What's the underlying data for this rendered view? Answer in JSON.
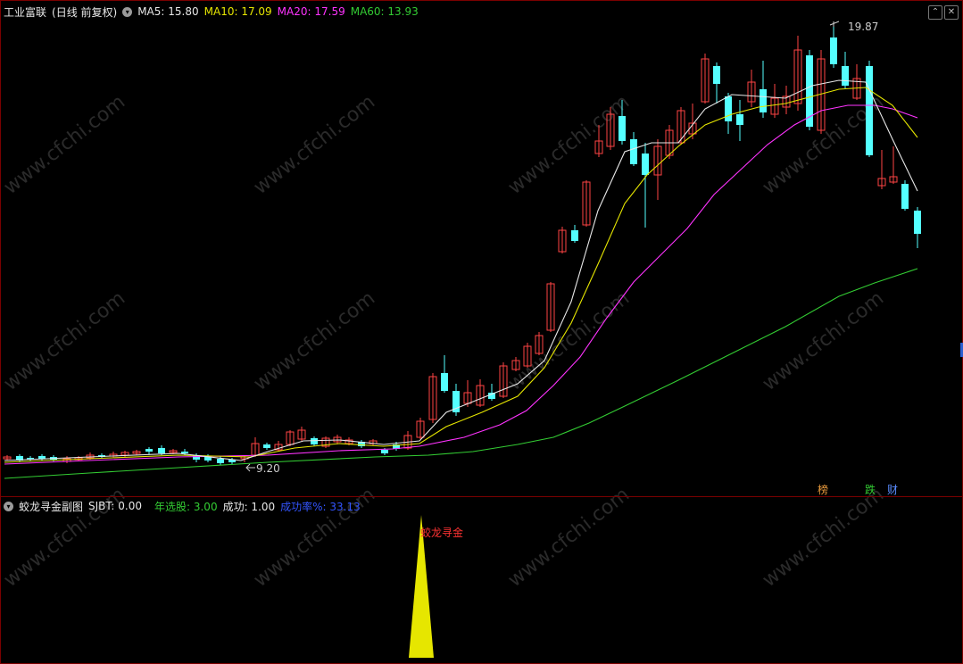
{
  "header": {
    "stock_name": "工业富联",
    "period": "(日线 前复权)",
    "ma": [
      {
        "label": "MA5: 15.80",
        "color": "#e8e8e8"
      },
      {
        "label": "MA10: 17.09",
        "color": "#e6e600"
      },
      {
        "label": "MA20: 17.59",
        "color": "#ff33ff"
      },
      {
        "label": "MA60: 13.93",
        "color": "#33cc33"
      }
    ]
  },
  "window_buttons": {
    "restore": "⌃",
    "close": "✕"
  },
  "main_chart": {
    "high_marker": "19.87",
    "low_marker": "9.20",
    "badges": [
      {
        "text": "榜",
        "color": "#e89a3c"
      },
      {
        "text": "跌",
        "color": "#33cc33"
      },
      {
        "text": "财",
        "color": "#5a8cff"
      }
    ]
  },
  "sub_header": {
    "indicator_name": "蛟龙寻金副图",
    "sjbt": "SJBT: 0.00",
    "nianxuangu": "年选股: 3.00",
    "chenggong": "成功: 1.00",
    "chenggonglv": "成功率%: 33.13"
  },
  "signal_label": "蛟龙寻金",
  "watermark": "www.cfchi.com",
  "colors": {
    "up": "#ff4444",
    "down": "#54ffff",
    "ma5": "#e8e8e8",
    "ma10": "#e6e600",
    "ma20": "#ff33ff",
    "ma60": "#33cc33",
    "signal": "#e6e600",
    "border": "#7a0000"
  },
  "chart_data": {
    "type": "candlestick",
    "price_high": 19.87,
    "price_low": 9.2,
    "series": [
      {
        "name": "MA5",
        "value": 15.8
      },
      {
        "name": "MA10",
        "value": 17.09
      },
      {
        "name": "MA20",
        "value": 17.59
      },
      {
        "name": "MA60",
        "value": 13.93
      }
    ],
    "subchart": {
      "sjbt": 0.0,
      "nianxuangu": 3.0,
      "chenggong": 1.0,
      "chenggonglv": 33.13
    }
  }
}
